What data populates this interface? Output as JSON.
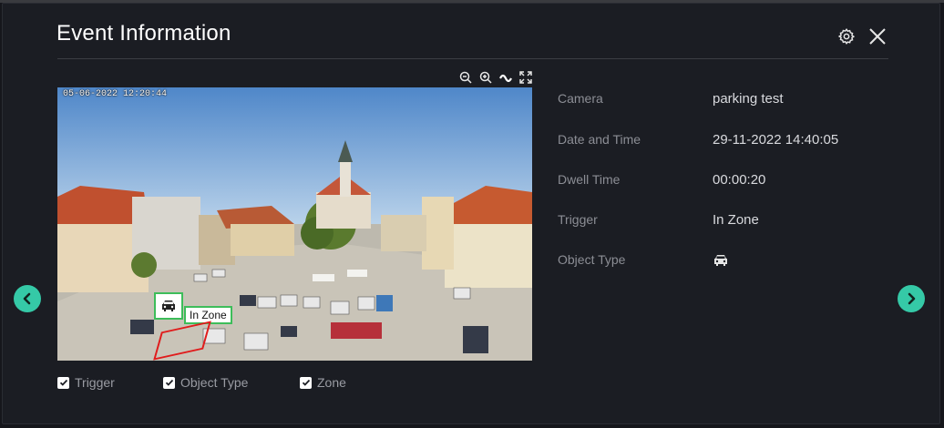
{
  "dialog": {
    "title": "Event Information"
  },
  "header_icons": {
    "settings": "gear-icon",
    "close": "close-icon"
  },
  "toolbar": {
    "icons": [
      "zoom-out-icon",
      "zoom-in-icon",
      "wave-icon",
      "fullscreen-icon"
    ]
  },
  "video": {
    "timestamp": "05-06-2022 12:20:44",
    "object_label": "In Zone"
  },
  "toggles": [
    {
      "label": "Trigger",
      "checked": true
    },
    {
      "label": "Object Type",
      "checked": true
    },
    {
      "label": "Zone",
      "checked": true
    }
  ],
  "details": {
    "camera": {
      "label": "Camera",
      "value": "parking test"
    },
    "datetime": {
      "label": "Date and Time",
      "value": "29-11-2022 14:40:05"
    },
    "dwell": {
      "label": "Dwell Time",
      "value": "00:00:20"
    },
    "trigger": {
      "label": "Trigger",
      "value": "In Zone"
    },
    "object_type": {
      "label": "Object Type",
      "icon": "car-icon"
    }
  },
  "colors": {
    "accent": "#35c9a7",
    "detection_box": "#3dbd5a",
    "zone": "#e01c1c",
    "dialog_bg": "#1b1d23"
  }
}
